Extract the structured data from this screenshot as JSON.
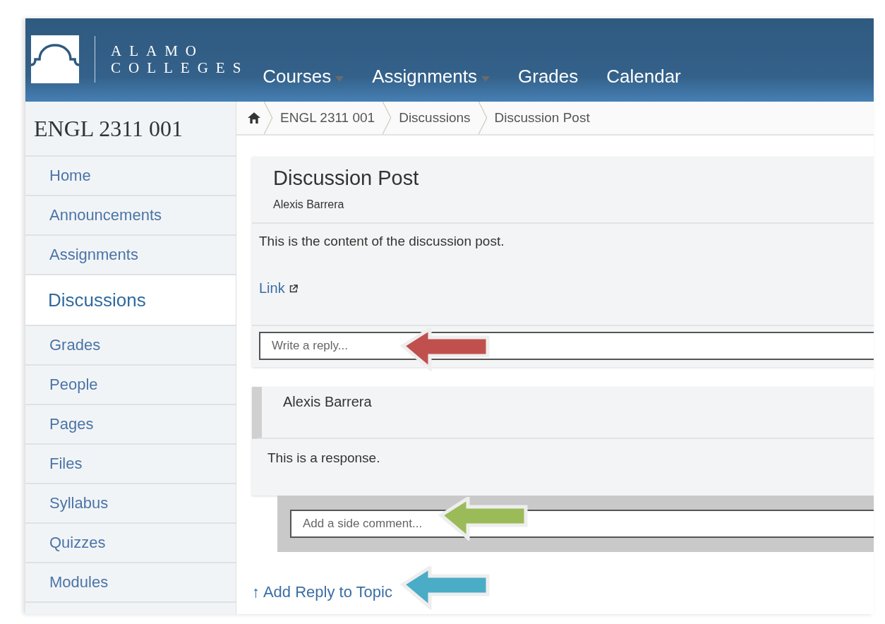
{
  "logo": {
    "line_1": "ALAMO",
    "line_2": "COLLEGES"
  },
  "top_nav": [
    {
      "label": "Courses",
      "dropdown": true
    },
    {
      "label": "Assignments",
      "dropdown": true
    },
    {
      "label": "Grades",
      "dropdown": false
    },
    {
      "label": "Calendar",
      "dropdown": false
    }
  ],
  "course_title": "ENGL 2311 001",
  "sidebar": {
    "items": [
      {
        "label": "Home",
        "selected": false
      },
      {
        "label": "Announcements",
        "selected": false
      },
      {
        "label": "Assignments",
        "selected": false
      },
      {
        "label": "Discussions",
        "selected": true
      },
      {
        "label": "Grades",
        "selected": false
      },
      {
        "label": "People",
        "selected": false
      },
      {
        "label": "Pages",
        "selected": false
      },
      {
        "label": "Files",
        "selected": false
      },
      {
        "label": "Syllabus",
        "selected": false
      },
      {
        "label": "Quizzes",
        "selected": false
      },
      {
        "label": "Modules",
        "selected": false
      }
    ]
  },
  "breadcrumb": [
    "ENGL 2311 001",
    "Discussions",
    "Discussion Post"
  ],
  "post": {
    "title": "Discussion Post",
    "author": "Alexis Barrera",
    "content": "This is the content of the discussion post.",
    "link": "Link"
  },
  "reply_box": {
    "placeholder": "Write a reply...",
    "callout": {
      "color": "#c0504d"
    }
  },
  "response": {
    "author": "Alexis Barrera",
    "content": "This is a response."
  },
  "side_comment": {
    "placeholder": "Add a side comment...",
    "callout": {
      "color": "#9bbb59"
    }
  },
  "add_reply": {
    "arrow": "↑",
    "label": "Add Reply to Topic",
    "callout": {
      "color": "#4bacc6"
    }
  }
}
